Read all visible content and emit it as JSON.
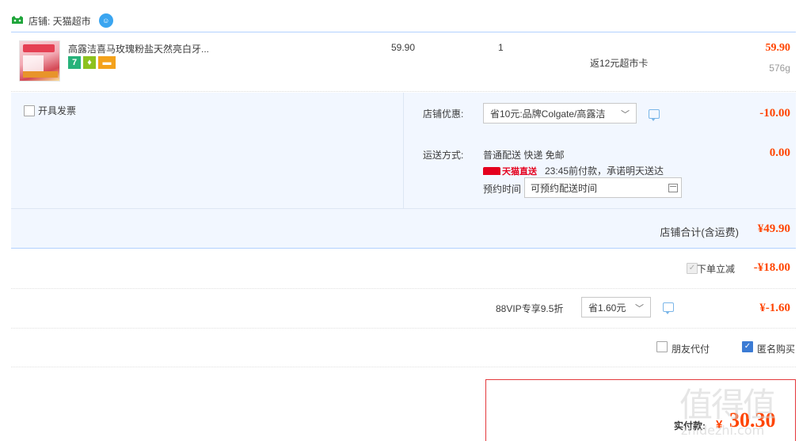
{
  "shop": {
    "label": "店铺: 天猫超市",
    "logo_icon": "tmall-supermarket-logo",
    "chat_icon": "wangwang-chat-icon"
  },
  "item": {
    "title": "高露洁喜马玫瑰粉盐天然亮白牙...",
    "service_icons": [
      "7",
      "shield",
      "card"
    ],
    "price": "59.90",
    "quantity": "1",
    "promo": "返12元超市卡",
    "total": "59.90",
    "weight": "576g"
  },
  "options": {
    "invoice_label": "开具发票",
    "coupon_label": "店铺优惠:",
    "coupon_value": "省10元:品牌Colgate/高露洁",
    "coupon_amount": "-10.00",
    "shipping_label": "运送方式:",
    "shipping_method": "普通配送 快递 免邮",
    "tmall_direct": "天猫直送",
    "delivery_promise": "23:45前付款，承诺明天送达",
    "schedule_label": "预约时间",
    "schedule_value": "可预约配送时间",
    "shipping_amount": "0.00"
  },
  "subtotal": {
    "label": "店铺合计(含运费)",
    "amount": "¥49.90"
  },
  "discount": {
    "label": "下单立减",
    "amount": "-¥18.00"
  },
  "vip": {
    "label": "88VIP专享9.5折",
    "select_value": "省1.60元",
    "amount": "¥-1.60"
  },
  "anonymous": {
    "friend_label": "朋友代付",
    "anon_label": "匿名购买",
    "anon_checked": true
  },
  "payment": {
    "label": "实付款:",
    "currency": "¥",
    "amount": "30.30"
  },
  "watermark": {
    "chars": "值得值",
    "url": "zhidezhi.com"
  },
  "colors": {
    "accent_red": "#f40",
    "border_blue": "#b2d1ff",
    "options_bg": "#f2f7ff",
    "checked_blue": "#3b7bd4"
  }
}
